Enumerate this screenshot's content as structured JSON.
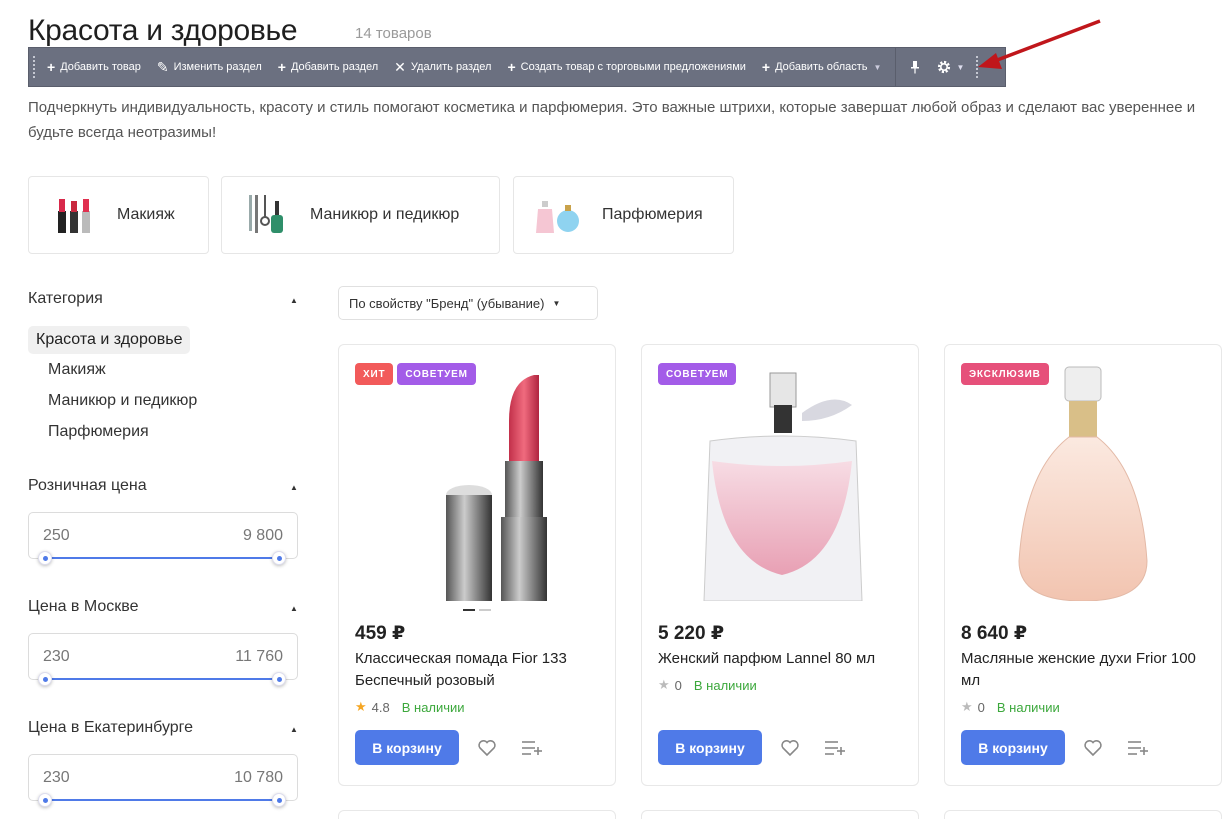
{
  "header": {
    "title": "Красота и здоровье",
    "count": "14 товаров"
  },
  "toolbar": {
    "add_product": "Добавить товар",
    "edit_section": "Изменить раздел",
    "add_section": "Добавить раздел",
    "delete_section": "Удалить раздел",
    "create_with_offers": "Создать товар с торговыми предложениями",
    "add_area": "Добавить область"
  },
  "description": "Подчеркнуть индивидуальность, красоту и стиль помогают косметика и парфюмерия. Это важные штрихи, которые завершат любой образ и сделают вас увереннее и будьте всегда неотразимы!",
  "tiles": [
    {
      "label": "Макияж",
      "icon": "lipsticks-icon"
    },
    {
      "label": "Маникюр и педикюр",
      "icon": "manicure-set-icon"
    },
    {
      "label": "Парфюмерия",
      "icon": "perfume-bottles-icon"
    }
  ],
  "sidebar": {
    "category_heading": "Категория",
    "active_item": "Красота и здоровье",
    "items": [
      "Макияж",
      "Маникюр и педикюр",
      "Парфюмерия"
    ],
    "filters": [
      {
        "label": "Розничная цена",
        "min": "250",
        "max": "9 800"
      },
      {
        "label": "Цена в Москве",
        "min": "230",
        "max": "11 760"
      },
      {
        "label": "Цена в Екатеринбурге",
        "min": "230",
        "max": "10 780"
      }
    ]
  },
  "sort": {
    "label": "По свойству \"Бренд\" (убывание)"
  },
  "cart_label": "В корзину",
  "products": [
    {
      "price": "459 ₽",
      "name": "Классическая помада Fior 133 Беспечный розовый",
      "rating": "4.8",
      "stock": "В наличии",
      "badges": [
        {
          "text": "ХИТ",
          "kind": "hit"
        },
        {
          "text": "СОВЕТУЕМ",
          "kind": "rec"
        }
      ]
    },
    {
      "price": "5 220 ₽",
      "name": "Женский парфюм Lannel 80 мл",
      "rating": "0",
      "stock": "В наличии",
      "badges": [
        {
          "text": "СОВЕТУЕМ",
          "kind": "rec"
        }
      ]
    },
    {
      "price": "8 640 ₽",
      "name": "Масляные женские духи Frior 100 мл",
      "rating": "0",
      "stock": "В наличии",
      "badges": [
        {
          "text": "ЭКСКЛЮЗИВ",
          "kind": "exc"
        }
      ]
    }
  ],
  "colors": {
    "accent": "#4f7ae8",
    "in_stock": "#3ca83c",
    "toolbar_bg": "#6b7080",
    "arrow": "#c0161b"
  }
}
